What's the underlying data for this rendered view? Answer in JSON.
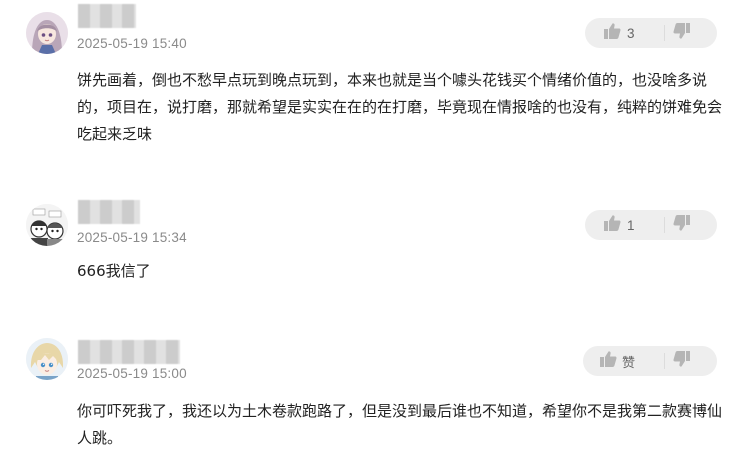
{
  "comments": [
    {
      "username": "",
      "timestamp": "2025-05-19 15:40",
      "upvote_label": "3",
      "text": "饼先画着，倒也不愁早点玩到晚点玩到，本来也就是当个噱头花钱买个情绪价值的，也没啥多说的，项目在，说打磨，那就希望是实实在在的在打磨，毕竟现在情报啥的也没有，纯粹的饼难免会吃起来乏味"
    },
    {
      "username": "",
      "timestamp": "2025-05-19 15:34",
      "upvote_label": "1",
      "text": "666我信了"
    },
    {
      "username": "",
      "timestamp": "2025-05-19 15:00",
      "upvote_label": "赞",
      "text": "你可吓死我了，我还以为土木卷款跑路了，但是没到最后谁也不知道，希望你不是我第二款赛博仙人跳。"
    }
  ],
  "icons": {
    "upvote": "thumbs-up-icon",
    "downvote": "thumbs-down-icon"
  },
  "colors": {
    "timestamp": "#8a8a8a",
    "vote_bg": "#eeeeee",
    "icon": "#b5b5b5"
  }
}
